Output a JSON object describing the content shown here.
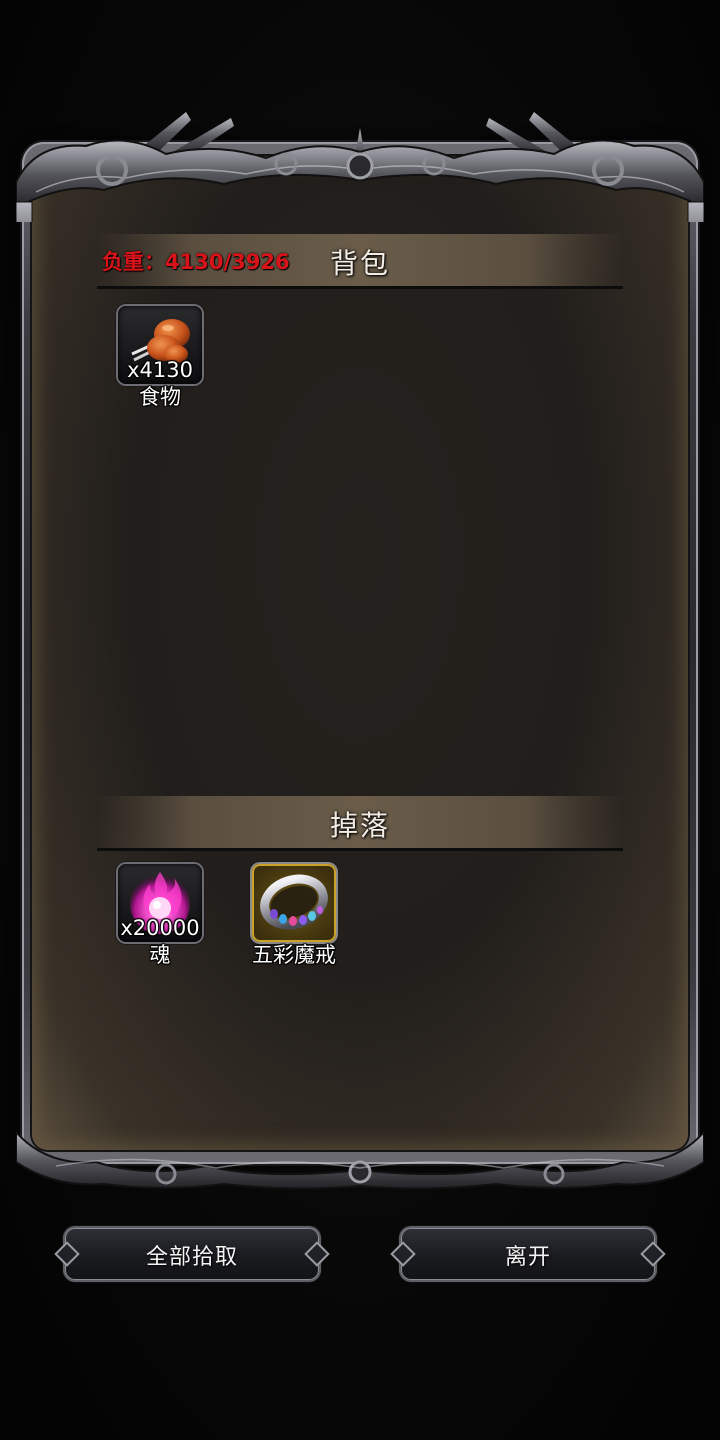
{
  "backpack": {
    "title": "背包",
    "weight_text": "负重：4130/3926",
    "items": [
      {
        "name": "食物",
        "quantity": "x4130",
        "icon": "roast-chicken-leg-icon"
      }
    ]
  },
  "drops": {
    "title": "掉落",
    "items": [
      {
        "name": "魂",
        "quantity": "x20000",
        "icon": "pink-soul-flame-icon"
      },
      {
        "name": "五彩魔戒",
        "quantity": "",
        "icon": "jeweled-ring-icon",
        "rarity_color": "#c9a227"
      }
    ]
  },
  "buttons": {
    "pickup_all": "全部拾取",
    "leave": "离开"
  },
  "colors": {
    "weight_overload": "#d8141a",
    "panel": "#211e1b",
    "frame": "#3a3a40"
  }
}
